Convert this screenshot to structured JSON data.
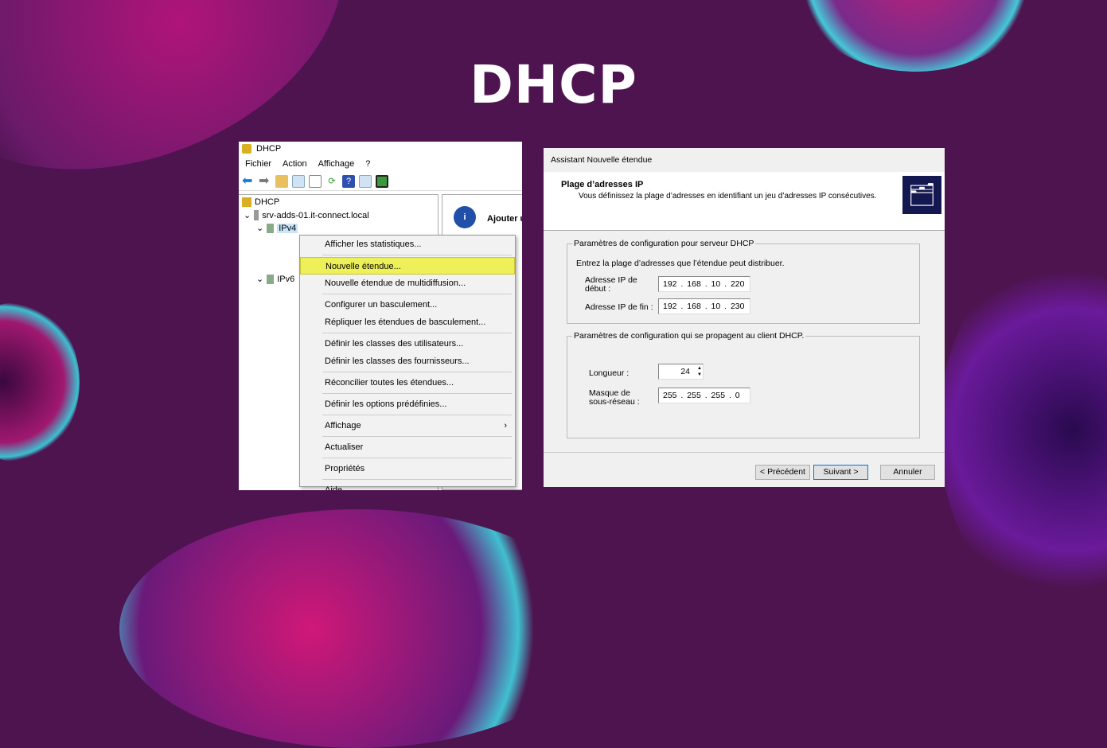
{
  "title": "DHCP",
  "mmc": {
    "window_title": "DHCP",
    "menu": [
      "Fichier",
      "Action",
      "Affichage",
      "?"
    ],
    "tree": {
      "root": "DHCP",
      "server": "srv-adds-01.it-connect.local",
      "ipv4": "IPv4",
      "ipv6": "IPv6"
    },
    "right_pane_heading": "Ajouter u",
    "context_menu": [
      [
        "Afficher les statistiques..."
      ],
      [
        "Nouvelle étendue...",
        "Nouvelle étendue de multidiffusion..."
      ],
      [
        "Configurer un basculement...",
        "Répliquer les étendues de basculement..."
      ],
      [
        "Définir les classes des utilisateurs...",
        "Définir les classes des fournisseurs..."
      ],
      [
        "Réconcilier toutes les étendues..."
      ],
      [
        "Définir les options prédéfinies..."
      ],
      [
        "Affichage"
      ],
      [
        "Actualiser"
      ],
      [
        "Propriétés"
      ],
      [
        "Aide"
      ]
    ],
    "selected_item": "Nouvelle étendue..."
  },
  "wizard": {
    "window_title": "Assistant Nouvelle étendue",
    "heading": "Plage d’adresses IP",
    "subheading": "Vous définissez la plage d’adresses en identifiant un jeu d’adresses IP consécutives.",
    "group1": {
      "legend": "Paramètres de configuration pour serveur DHCP",
      "intro": "Entrez la plage d’adresses que l’étendue peut distribuer.",
      "start_label": "Adresse IP de début :",
      "start_value": "192 . 168 . 10 . 220",
      "end_label": "Adresse IP de fin :",
      "end_value": "192 . 168 . 10 . 230"
    },
    "group2": {
      "legend": "Paramètres de configuration qui se propagent au client DHCP.",
      "length_label": "Longueur :",
      "length_value": "24",
      "mask_label": "Masque de sous-réseau :",
      "mask_value": "255 . 255 . 255 . 0"
    },
    "buttons": {
      "back": "< Précédent",
      "next": "Suivant >",
      "cancel": "Annuler"
    }
  },
  "colors": {
    "background": "#4e1450",
    "highlight": "#eef05a"
  }
}
